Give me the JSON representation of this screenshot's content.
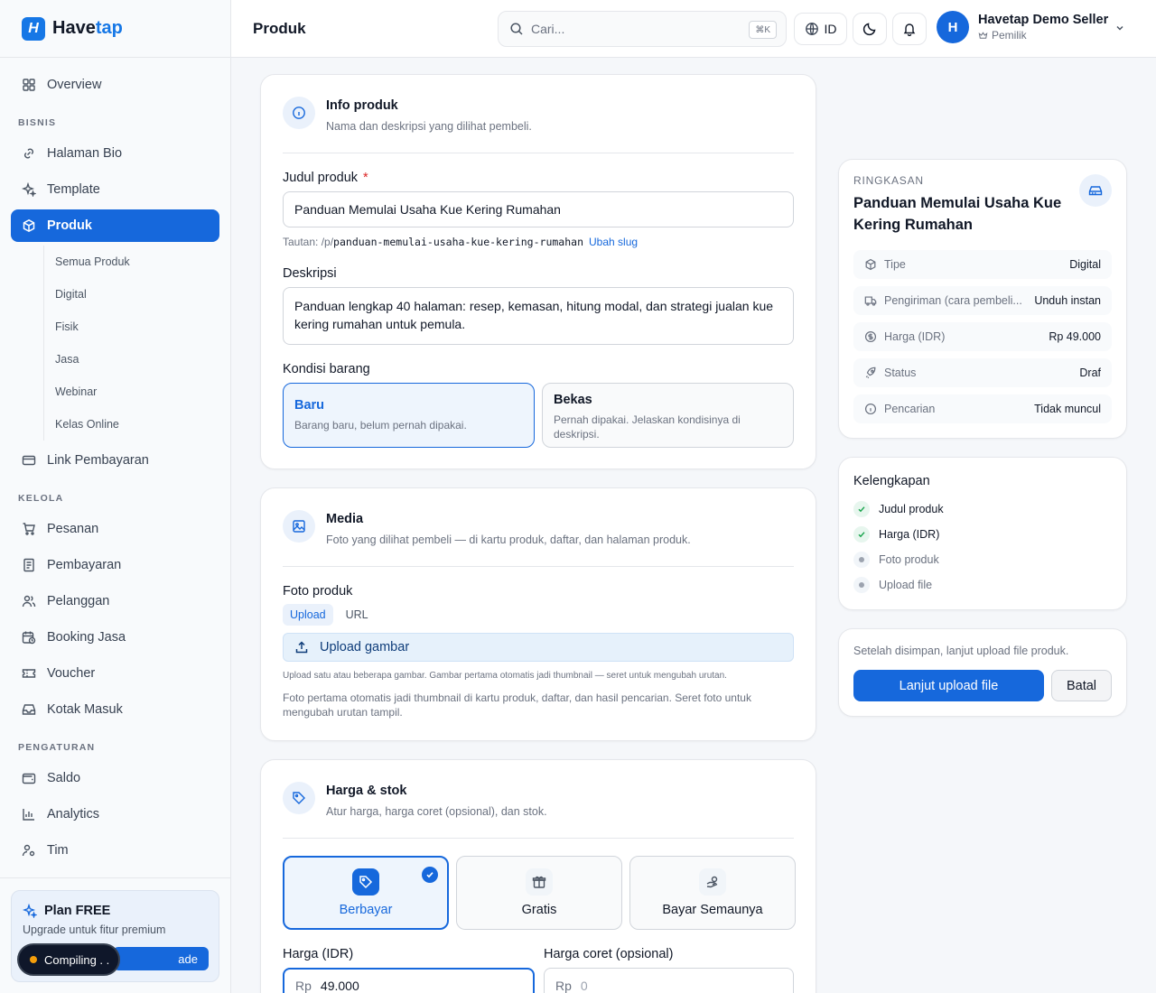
{
  "brand": {
    "logo_glyph": "H",
    "name_part1": "Have",
    "name_part2": "tap",
    "accent_color": "#1668dc"
  },
  "header": {
    "title": "Produk",
    "search_placeholder": "Cari...",
    "search_shortcut": "⌘K",
    "language": "ID",
    "user": {
      "initial": "H",
      "name": "Havetap Demo Seller",
      "role": "Pemilik"
    }
  },
  "sidebar": {
    "overview": "Overview",
    "section_bisnis": "BISNIS",
    "halaman_bio": "Halaman Bio",
    "template": "Template",
    "produk": "Produk",
    "sub": [
      "Semua Produk",
      "Digital",
      "Fisik",
      "Jasa",
      "Webinar",
      "Kelas Online"
    ],
    "link_pembayaran": "Link Pembayaran",
    "section_kelola": "KELOLA",
    "pesanan": "Pesanan",
    "pembayaran": "Pembayaran",
    "pelanggan": "Pelanggan",
    "booking_jasa": "Booking Jasa",
    "voucher": "Voucher",
    "kotak_masuk": "Kotak Masuk",
    "section_pengaturan": "PENGATURAN",
    "saldo": "Saldo",
    "analytics": "Analytics",
    "tim": "Tim",
    "plan_title": "Plan FREE",
    "plan_sub": "Upgrade untuk fitur premium",
    "plan_btn": "ade",
    "compiling": "Compiling  . ."
  },
  "info": {
    "title": "Info produk",
    "subtitle": "Nama dan deskripsi yang dilihat pembeli.",
    "judul_label": "Judul produk",
    "required_mark": "*",
    "judul_value": "Panduan Memulai Usaha Kue Kering Rumahan",
    "slug_prefix": "Tautan: /p/",
    "slug_value": "panduan-memulai-usaha-kue-kering-rumahan",
    "slug_link": "Ubah slug",
    "deskripsi_label": "Deskripsi",
    "deskripsi_value": "Panduan lengkap 40 halaman: resep, kemasan, hitung modal, dan strategi jualan kue kering rumahan untuk pemula.",
    "kondisi_label": "Kondisi barang",
    "kondisi": [
      {
        "title": "Baru",
        "sub": "Barang baru, belum pernah dipakai.",
        "selected": true
      },
      {
        "title": "Bekas",
        "sub": "Pernah dipakai. Jelaskan kondisinya di deskripsi.",
        "selected": false
      }
    ]
  },
  "media": {
    "title": "Media",
    "subtitle": "Foto yang dilihat pembeli — di kartu produk, daftar, dan halaman produk.",
    "foto_label": "Foto produk",
    "tabs": [
      "Upload",
      "URL"
    ],
    "upload_btn": "Upload gambar",
    "hint": "Upload satu atau beberapa gambar. Gambar pertama otomatis jadi thumbnail — seret untuk mengubah urutan.",
    "note": "Foto pertama otomatis jadi thumbnail di kartu produk, daftar, dan hasil pencarian. Seret foto untuk mengubah urutan tampil."
  },
  "harga": {
    "title": "Harga & stok",
    "subtitle": "Atur harga, harga coret (opsional), dan stok.",
    "options": [
      "Berbayar",
      "Gratis",
      "Bayar Semaunya"
    ],
    "harga_label": "Harga (IDR)",
    "harga_prefix": "Rp",
    "harga_value": "49.000",
    "coret_label": "Harga coret (opsional)",
    "coret_prefix": "Rp",
    "coret_placeholder": "0"
  },
  "summary": {
    "label": "RINGKASAN",
    "title": "Panduan Memulai Usaha Kue Kering Rumahan",
    "rows": [
      {
        "key": "Tipe",
        "value": "Digital"
      },
      {
        "key": "Pengiriman (cara pembeli...",
        "value": "Unduh instan"
      },
      {
        "key": "Harga (IDR)",
        "value": "Rp 49.000"
      },
      {
        "key": "Status",
        "value": "Draf"
      },
      {
        "key": "Pencarian",
        "value": "Tidak muncul"
      }
    ]
  },
  "completeness": {
    "title": "Kelengkapan",
    "items": [
      {
        "label": "Judul produk",
        "done": true
      },
      {
        "label": "Harga (IDR)",
        "done": true
      },
      {
        "label": "Foto produk",
        "done": false
      },
      {
        "label": "Upload file",
        "done": false
      }
    ]
  },
  "actions": {
    "note": "Setelah disimpan, lanjut upload file produk.",
    "primary": "Lanjut upload file",
    "cancel": "Batal"
  }
}
